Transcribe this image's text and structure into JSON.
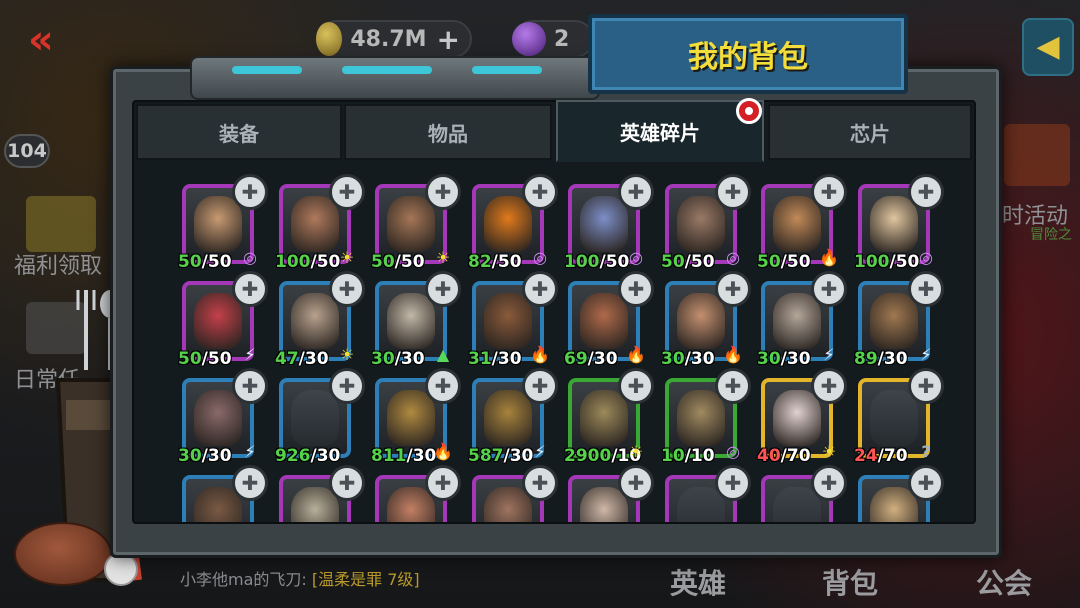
{
  "top_bar": {
    "coins": "48.7M",
    "gems": "2",
    "plus": "+",
    "level": "104",
    "back": "«"
  },
  "background": {
    "side_labels": [
      "福利领取",
      "日常任",
      "时活动",
      "冒险之"
    ],
    "bottom_nav": [
      "英雄",
      "背包",
      "公会"
    ],
    "chat": {
      "prefix": "小李他ma的飞刀: ",
      "highlight": "[温柔是罪 7级]"
    }
  },
  "window": {
    "title": "我的背包",
    "tabs": [
      {
        "label": "装备",
        "active": false
      },
      {
        "label": "物品",
        "active": false
      },
      {
        "label": "英雄碎片",
        "active": true
      },
      {
        "label": "芯片",
        "active": false
      }
    ]
  },
  "cards": [
    {
      "rarity": "purple",
      "have": "50",
      "need": "/50",
      "elem": "swirl",
      "skin": "#c89a72"
    },
    {
      "rarity": "purple",
      "have": "100",
      "need": "/50",
      "elem": "sun",
      "skin": "#b07a5c"
    },
    {
      "rarity": "purple",
      "have": "50",
      "need": "/50",
      "elem": "sun",
      "skin": "#a57656"
    },
    {
      "rarity": "purple",
      "have": "82",
      "need": "/50",
      "elem": "swirl",
      "skin": "#e07a1c"
    },
    {
      "rarity": "purple",
      "have": "100",
      "need": "/50",
      "elem": "swirl",
      "skin": "#7d8fc8"
    },
    {
      "rarity": "purple",
      "have": "50",
      "need": "/50",
      "elem": "swirl",
      "skin": "#9a7a66"
    },
    {
      "rarity": "purple",
      "have": "50",
      "need": "/50",
      "elem": "fire",
      "skin": "#c28a58"
    },
    {
      "rarity": "purple",
      "have": "100",
      "need": "/50",
      "elem": "swirl",
      "skin": "#e0c6a0"
    },
    {
      "rarity": "purple",
      "have": "50",
      "need": "/50",
      "elem": "bolt",
      "skin": "#c4404a"
    },
    {
      "rarity": "blue",
      "have": "47",
      "need": "/30",
      "elem": "sun",
      "skin": "#b8a28e"
    },
    {
      "rarity": "blue",
      "have": "30",
      "need": "/30",
      "elem": "leaf",
      "skin": "#c2b8a8"
    },
    {
      "rarity": "blue",
      "have": "31",
      "need": "/30",
      "elem": "fire",
      "skin": "#8a5a3a"
    },
    {
      "rarity": "blue",
      "have": "69",
      "need": "/30",
      "elem": "fire",
      "skin": "#b06a4a"
    },
    {
      "rarity": "blue",
      "have": "30",
      "need": "/30",
      "elem": "fire",
      "skin": "#c49070"
    },
    {
      "rarity": "blue",
      "have": "30",
      "need": "/30",
      "elem": "bolt",
      "skin": "#b4a69a"
    },
    {
      "rarity": "blue",
      "have": "89",
      "need": "/30",
      "elem": "bolt",
      "skin": "#a07850"
    },
    {
      "rarity": "blue",
      "have": "30",
      "need": "/30",
      "elem": "bolt",
      "skin": "#8a6a6a"
    },
    {
      "rarity": "blue",
      "have": "926",
      "need": "/30",
      "elem": "",
      "skin": "silhouette"
    },
    {
      "rarity": "blue",
      "have": "811",
      "need": "/30",
      "elem": "fire",
      "skin": "#b08a40"
    },
    {
      "rarity": "blue",
      "have": "587",
      "need": "/30",
      "elem": "bolt",
      "skin": "#a8843c"
    },
    {
      "rarity": "green",
      "have": "2900",
      "need": "/10",
      "elem": "sun",
      "skin": "#9c8a5a"
    },
    {
      "rarity": "green",
      "have": "10",
      "need": "/10",
      "elem": "swirl",
      "skin": "#a08a60"
    },
    {
      "rarity": "gold",
      "have": "40",
      "need": "/70",
      "elem": "sun",
      "low": true,
      "skin": "#e2d2d2"
    },
    {
      "rarity": "gold",
      "have": "24",
      "need": "/70",
      "elem": "unknown",
      "low": true,
      "skin": "silhouette"
    },
    {
      "rarity": "blue",
      "have": "",
      "need": "",
      "elem": "",
      "skin": "#7a5a44"
    },
    {
      "rarity": "purple",
      "have": "",
      "need": "",
      "elem": "",
      "skin": "#b8b09a"
    },
    {
      "rarity": "purple",
      "have": "",
      "need": "",
      "elem": "",
      "skin": "#c48064"
    },
    {
      "rarity": "purple",
      "have": "",
      "need": "",
      "elem": "",
      "skin": "#a07460"
    },
    {
      "rarity": "purple",
      "have": "",
      "need": "",
      "elem": "",
      "skin": "#d0b8a8"
    },
    {
      "rarity": "purple",
      "have": "",
      "need": "",
      "elem": "",
      "skin": "silhouette"
    },
    {
      "rarity": "purple",
      "have": "",
      "need": "",
      "elem": "",
      "skin": "silhouette"
    },
    {
      "rarity": "blue",
      "have": "",
      "need": "",
      "elem": "",
      "skin": "#d2b080"
    }
  ],
  "icons": {
    "piece": "puzzle-piece-icon",
    "sun": "☀",
    "fire": "🔥",
    "bolt": "⚡",
    "swirl": "◎",
    "leaf": "▲",
    "unknown": "?"
  }
}
